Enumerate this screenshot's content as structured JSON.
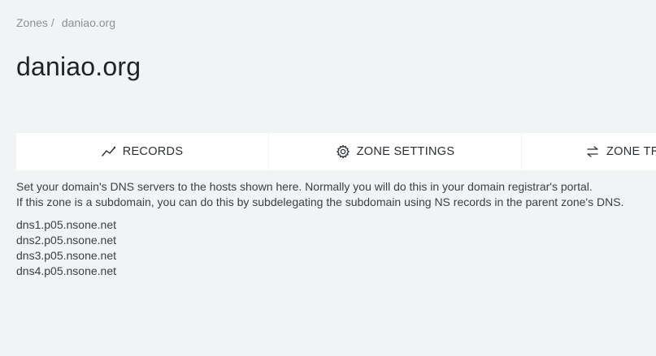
{
  "breadcrumb": {
    "root": "Zones",
    "separator": "/",
    "current": "daniao.org"
  },
  "page_title": "daniao.org",
  "tabs": [
    {
      "label": "RECORDS",
      "icon": "chart-line-icon"
    },
    {
      "label": "ZONE SETTINGS",
      "icon": "gear-icon"
    },
    {
      "label": "ZONE TR",
      "icon": "transfer-arrows-icon"
    }
  ],
  "description": {
    "line1": "Set your domain's DNS servers to the hosts shown here. Normally you will do this in your domain registrar's portal.",
    "line2": "If this zone is a subdomain, you can do this by subdelegating the subdomain using NS records in the parent zone's DNS."
  },
  "nameservers": [
    "dns1.p05.nsone.net",
    "dns2.p05.nsone.net",
    "dns3.p05.nsone.net",
    "dns4.p05.nsone.net"
  ],
  "colors": {
    "background": "#f1f4f5",
    "tab_background": "#ffffff",
    "title_text": "#1d2226",
    "muted_text": "#8a9196"
  }
}
